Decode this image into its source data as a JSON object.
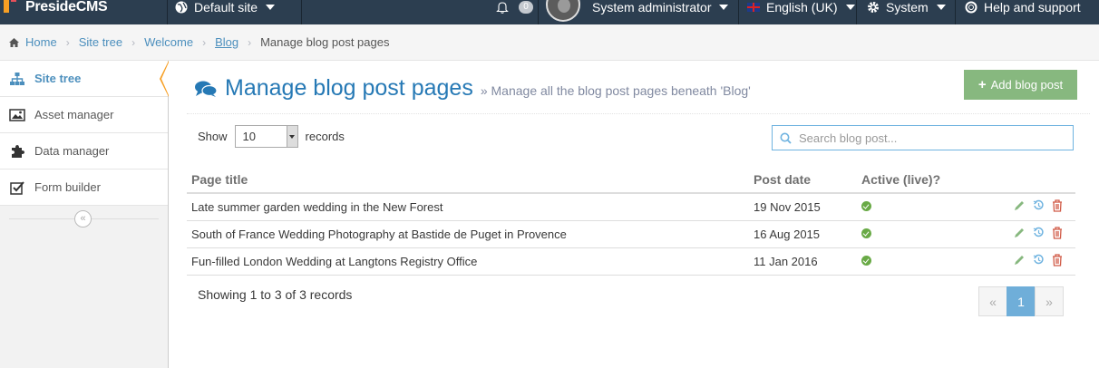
{
  "navbar": {
    "brand": "PresideCMS",
    "site": "Default site",
    "notifications_count": "0",
    "user": "System administrator",
    "language": "English (UK)",
    "system": "System",
    "help": "Help and support"
  },
  "breadcrumb": {
    "items": [
      "Home",
      "Site tree",
      "Welcome",
      "Blog"
    ],
    "current": "Manage blog post pages"
  },
  "sidebar": {
    "items": [
      {
        "label": "Site tree",
        "icon": "sitemap-icon",
        "active": true
      },
      {
        "label": "Asset manager",
        "icon": "picture-icon",
        "active": false
      },
      {
        "label": "Data manager",
        "icon": "puzzle-icon",
        "active": false
      },
      {
        "label": "Form builder",
        "icon": "check-square-icon",
        "active": false
      }
    ]
  },
  "header": {
    "title": "Manage blog post pages",
    "subtitle": "Manage all the blog post pages beneath 'Blog'",
    "add_button": "Add blog post"
  },
  "controls": {
    "show_label": "Show",
    "records_label": "records",
    "page_size": "10",
    "search_placeholder": "Search blog post..."
  },
  "table": {
    "columns": [
      "Page title",
      "Post date",
      "Active (live)?"
    ],
    "rows": [
      {
        "title": "Late summer garden wedding in the New Forest",
        "date": "19 Nov 2015",
        "active": true
      },
      {
        "title": "South of France Wedding Photography at Bastide de Puget in Provence",
        "date": "16 Aug 2015",
        "active": true
      },
      {
        "title": "Fun-filled London Wedding at Langtons Registry Office",
        "date": "11 Jan 2016",
        "active": true
      }
    ]
  },
  "footer": {
    "info": "Showing 1 to 3 of 3 records",
    "prev": "«",
    "page": "1",
    "next": "»"
  },
  "colors": {
    "navbar": "#2c3e50",
    "accent_blue": "#2679b5",
    "add_green": "#87b87f",
    "active_orange": "#f79f24"
  }
}
